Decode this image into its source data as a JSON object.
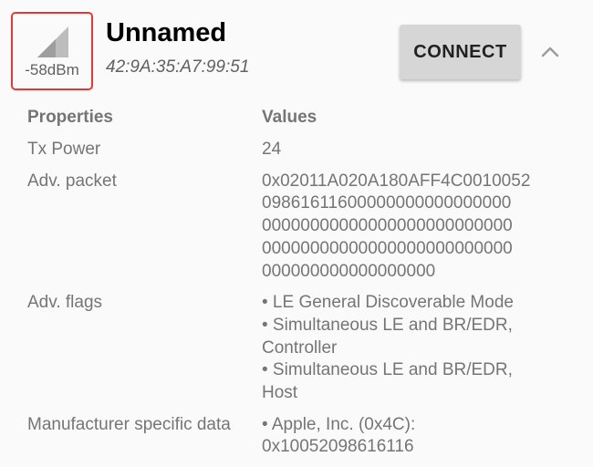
{
  "device": {
    "signal_label": "-58dBm",
    "name": "Unnamed",
    "address": "42:9A:35:A7:99:51"
  },
  "actions": {
    "connect_label": "CONNECT",
    "collapse_icon": "chevron-up-icon"
  },
  "table": {
    "header_key": "Properties",
    "header_value": "Values",
    "rows": [
      {
        "key": "Tx Power",
        "lines": [
          "24"
        ]
      },
      {
        "key": "Adv. packet",
        "lines": [
          "0x02011A020A180AFF4C0010052",
          "09861611600000000000000000",
          "00000000000000000000000000",
          "00000000000000000000000000",
          "000000000000000000"
        ]
      },
      {
        "key": "Adv. flags",
        "lines": [
          "• LE General Discoverable Mode",
          "• Simultaneous LE and BR/EDR,",
          "Controller",
          "• Simultaneous LE and BR/EDR,",
          "Host"
        ]
      },
      {
        "key": "Manufacturer specific data",
        "lines": [
          "• Apple, Inc. (0x4C):",
          "0x10052098616116"
        ]
      }
    ]
  }
}
